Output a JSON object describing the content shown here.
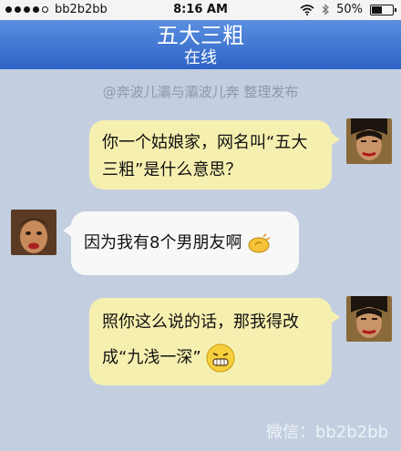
{
  "status_bar": {
    "carrier": "bb2b2bb",
    "time": "8:16 AM",
    "battery": "50%",
    "signal_bars_filled": 4,
    "signal_bars_total": 5,
    "icons": [
      "wifi-icon",
      "bluetooth-icon",
      "battery-icon"
    ]
  },
  "header": {
    "contact_name": "五大三粗",
    "presence": "在线"
  },
  "credit": "@奔波儿灞与灞波儿奔 整理发布",
  "messages": [
    {
      "direction": "outgoing",
      "text_line1": "你一个姑娘家，网名叫“五大",
      "text_line2": "三粗”是什么意思？"
    },
    {
      "direction": "incoming",
      "text": "因为我有8个男朋友啊",
      "emoji": "hand-wave-emoji"
    },
    {
      "direction": "outgoing",
      "text_line1": "照你这么说的话，那我得改",
      "text_line2": "成“九浅一深”",
      "emoji": "grin-emoji"
    }
  ],
  "watermark": "微信：bb2b2bb",
  "colors": {
    "title_bar": "#3a72d4",
    "background": "#c3cfe0",
    "outgoing_bubble": "#f6f0b0",
    "incoming_bubble": "#f8f8f8"
  }
}
